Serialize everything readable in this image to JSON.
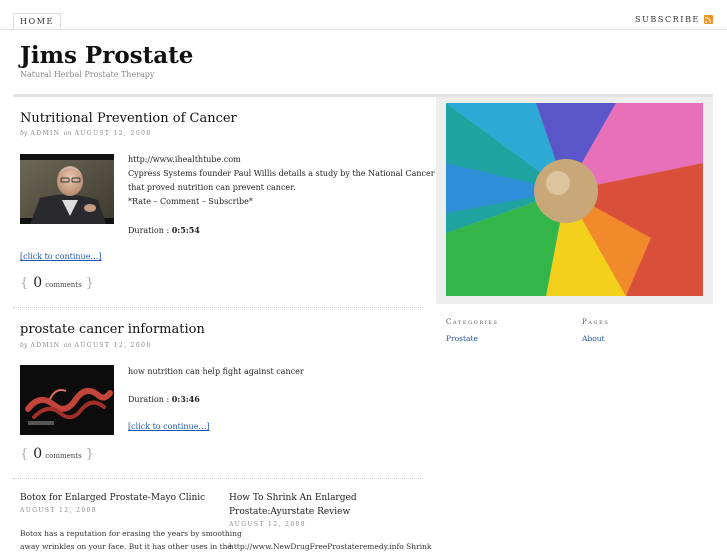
{
  "nav": {
    "home": "Home",
    "subscribe": "Subscribe"
  },
  "header": {
    "title": "Jims Prostate",
    "tagline": "Natural Herbal Prostate Therapy"
  },
  "posts": [
    {
      "title": "Nutritional Prevention of Cancer",
      "by": "by",
      "author": "Admin",
      "on": "on",
      "date": "August 12, 2008",
      "url_line": "http://www.ihealthtube.com",
      "description_1": "Cypress Systems founder Paul Willis details a study by the National Cancer Institute",
      "description_2": "that proved nutrition can prevent cancer.",
      "rate_line": "*Rate – Comment – Subscribe*",
      "duration_label": "Duration :",
      "duration": "0:5:54",
      "more": "[click to continue…]",
      "comment_count": "0",
      "comment_word": "comments"
    },
    {
      "title": "prostate cancer information",
      "by": "by",
      "author": "Admin",
      "on": "on",
      "date": "August 12, 2008",
      "description_1": "how nutrition can help fight against cancer",
      "duration_label": "Duration :",
      "duration": "0:3:46",
      "more": "[click to continue…]",
      "comment_count": "0",
      "comment_word": "comments"
    }
  ],
  "mini_posts": [
    {
      "title_1": "Botox for Enlarged Prostate-Mayo Clinic",
      "date": "August 12, 2008",
      "text_1": "Botox has a reputation for erasing the years by smoothing",
      "text_2": "away wrinkles on your face. But it has other uses in the"
    },
    {
      "title_1": "How To Shrink An Enlarged",
      "title_2": "Prostate:Ayurstate Review",
      "date": "August 12, 2008",
      "text_1": "http://www.NewDrugFreeProstateremedy.info Shrink"
    }
  ],
  "sidebar": {
    "categories_heading": "Categories",
    "categories": [
      "Prostate"
    ],
    "pages_heading": "Pages",
    "pages": [
      "About"
    ]
  },
  "colors": {
    "link": "#2255aa",
    "rss": "#f39422"
  }
}
